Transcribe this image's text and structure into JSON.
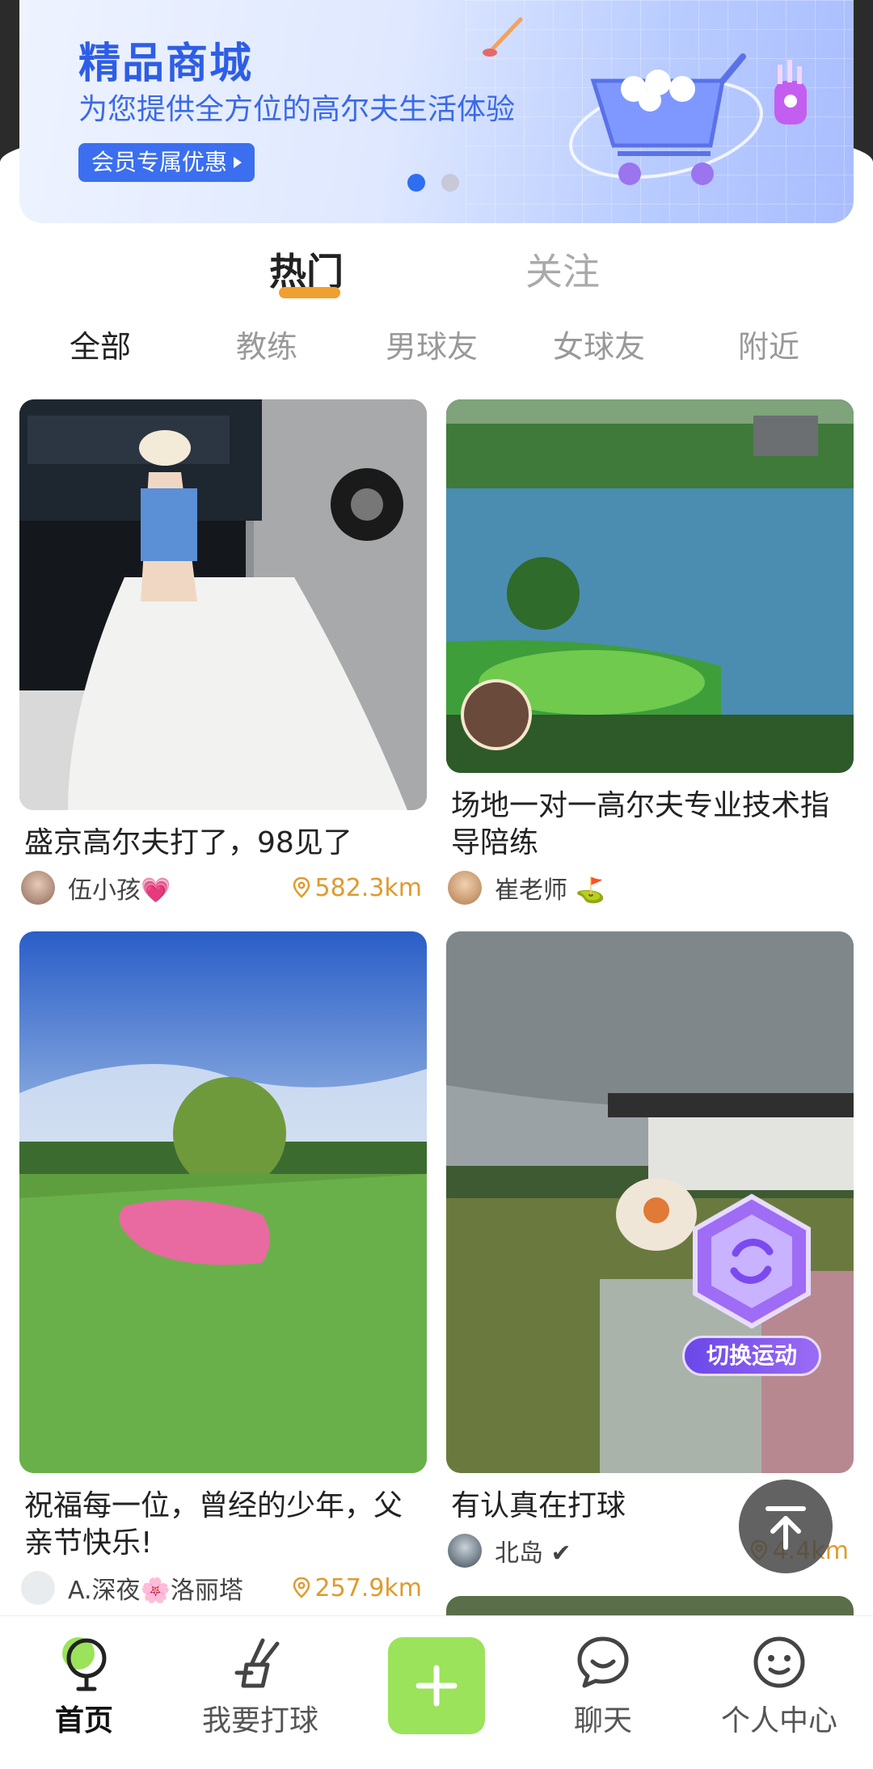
{
  "banner": {
    "title": "精品商城",
    "subtitle": "为您提供全方位的高尔夫生活体验",
    "cta": "会员专属优惠",
    "active_slide": 1,
    "slide_count": 2
  },
  "main_tabs": [
    "热门",
    "关注"
  ],
  "sub_tabs": [
    "全部",
    "教练",
    "男球友",
    "女球友",
    "附近"
  ],
  "posts": [
    {
      "title": "盛京高尔夫打了，98见了",
      "user": "伍小孩💗",
      "distance": "582.3km"
    },
    {
      "title": "场地一对一高尔夫专业技术指导陪练",
      "user": "崔老师 ⛳",
      "distance": ""
    },
    {
      "title": "祝福每一位，曾经的少年，父亲节快乐!",
      "user": "A.深夜🌸洛丽塔",
      "distance": "257.9km"
    },
    {
      "title": "有认真在打球",
      "user": "北岛 ✔",
      "distance": "4.4km"
    }
  ],
  "float_badge": "切换运动",
  "bottom_nav": [
    "首页",
    "我要打球",
    "",
    "聊天",
    "个人中心"
  ],
  "colors": {
    "accent": "#f0a030",
    "brand_blue": "#2e5ee6",
    "plus_green": "#9be35a",
    "distance": "#e09a2c"
  }
}
